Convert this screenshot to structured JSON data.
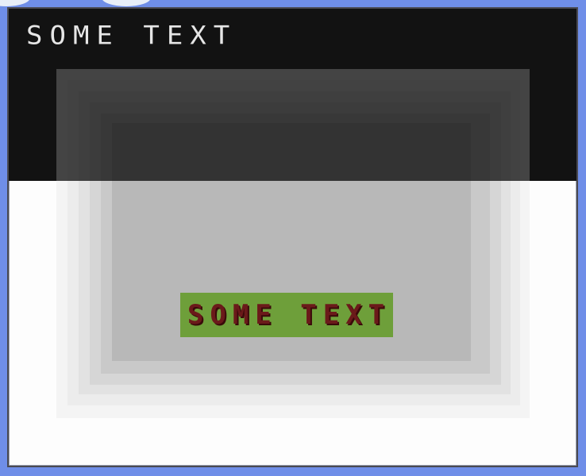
{
  "window": {
    "header_text": "SOME TEXT"
  },
  "button": {
    "label": "SOME TEXT",
    "background_color": "#6e9f3a",
    "text_color": "#6b1a1a"
  },
  "colors": {
    "sky": "#6f8ee8",
    "panel_dark": "#424242",
    "panel_light": "#fdfdfd"
  }
}
